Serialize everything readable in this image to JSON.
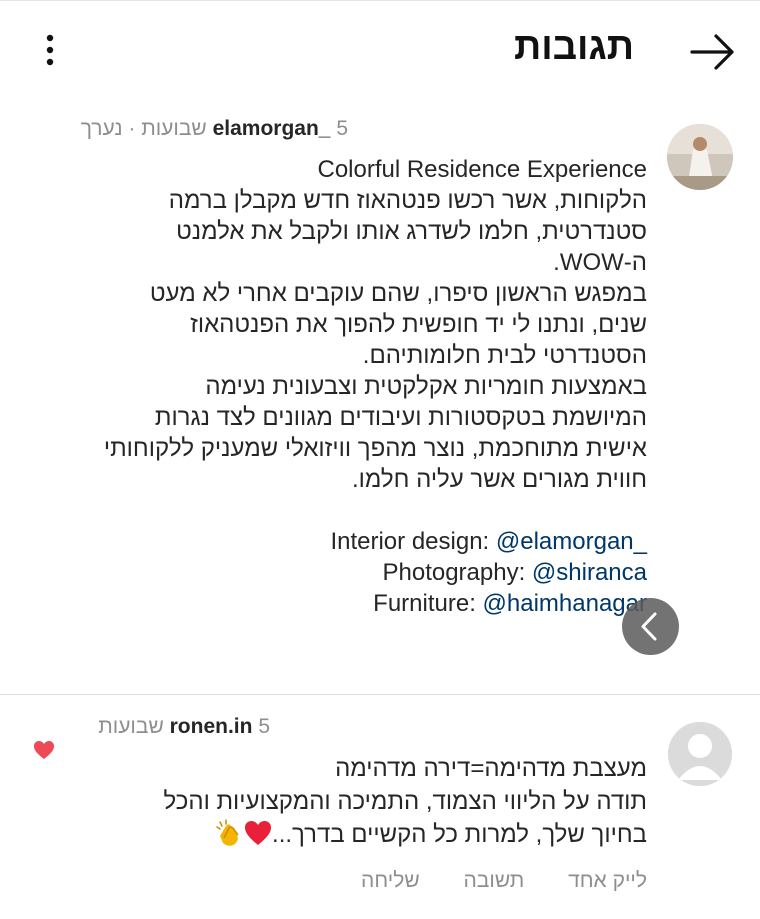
{
  "header": {
    "title": "תגובות",
    "back_icon": "arrow-right-icon",
    "more_icon": "more-vertical-icon"
  },
  "post": {
    "username": "elamorgan_",
    "time": "5 שבועות",
    "edited": "נערך",
    "separator": "·",
    "caption_title": "Colorful Residence Experience",
    "caption_lines": [
      "הלקוחות, אשר רכשו פנטהאוז חדש מקבלן ברמה",
      "סטנדרטית, חלמו לשדרג אותו ולקבל את אלמנט",
      "ה-WOW.",
      "במפגש הראשון סיפרו, שהם עוקבים אחרי לא מעט",
      "שנים, ונתנו לי יד חופשית להפוך את הפנטהאוז",
      "הסטנדרטי לבית חלומותיהם.",
      "באמצעות חומריות אקלקטית וצבעונית נעימה",
      "המיושמת בטקסטורות ועיבודים מגוונים לצד נגרות",
      "אישית מתוחכמת, נוצר מהפך וויזואלי שמעניק ללקוחותי",
      "חווית מגורים אשר עליה חלמו."
    ],
    "credits": [
      {
        "label": "Interior design: ",
        "mention": "@elamorgan",
        "suffix": "_"
      },
      {
        "label": "Photography: ",
        "mention": "@shiranca",
        "suffix": ""
      },
      {
        "label": "Furniture: ",
        "mention": "@haimhanagar",
        "suffix": ""
      }
    ]
  },
  "comment": {
    "username": "ronen.in",
    "time": "5 שבועות",
    "lines": [
      "מעצבת מדהימה=דירה מדהימה",
      "תודה על הליווי הצמוד, התמיכה והמקצועיות והכל",
      "בחיוך שלך, למרות כל הקשיים בדרך..."
    ],
    "emojis": [
      "red-heart-emoji",
      "clapping-hands-emoji"
    ],
    "likes_label": "לייק אחד",
    "reply_label": "תשובה",
    "send_label": "שליחה",
    "liked": true
  },
  "colors": {
    "text": "#262626",
    "secondary": "#8e8e8e",
    "mention": "#00376b",
    "heart": "#ed4956"
  }
}
